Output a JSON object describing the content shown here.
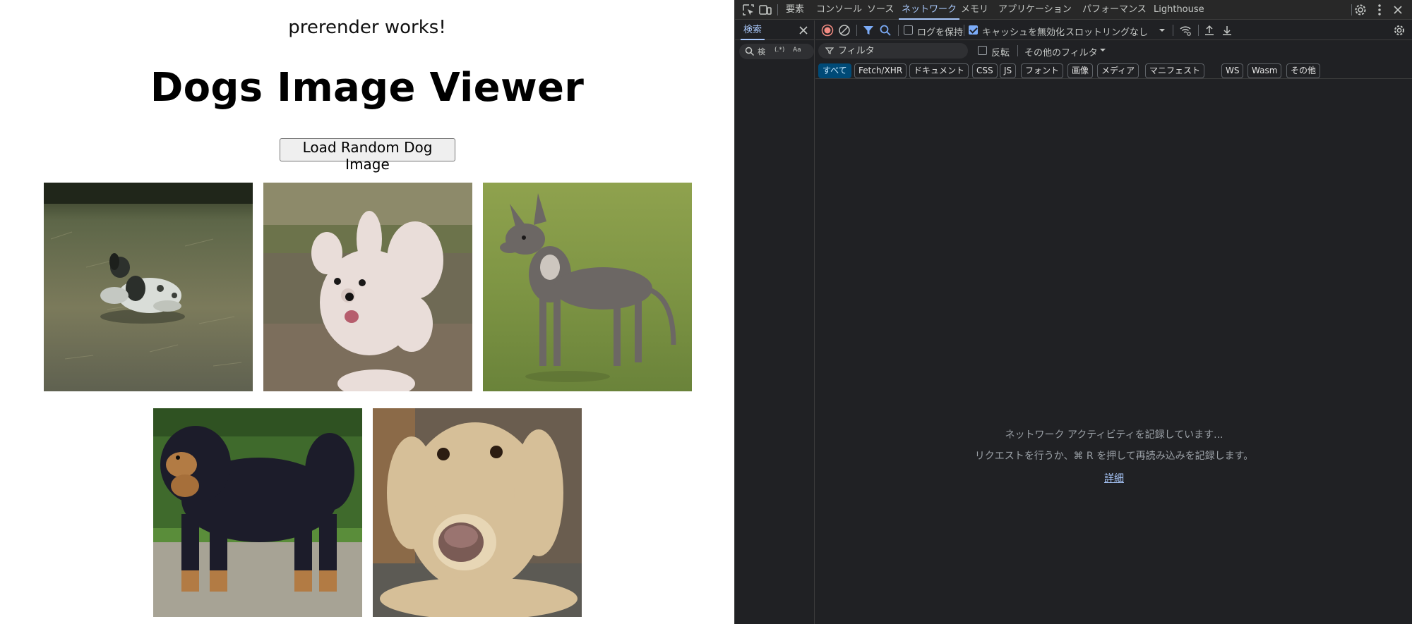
{
  "page": {
    "prerender_text": "prerender works!",
    "title": "Dogs Image Viewer",
    "load_button": "Load Random Dog Image",
    "dogs": [
      {
        "name": "spaniel-on-grass"
      },
      {
        "name": "fluffy-white-dog"
      },
      {
        "name": "hairless-dog"
      },
      {
        "name": "tibetan-mastiff"
      },
      {
        "name": "golden-retriever"
      }
    ]
  },
  "devtools": {
    "tabs": [
      "要素",
      "コンソール",
      "ソース",
      "ネットワーク",
      "メモリ",
      "アプリケーション",
      "パフォーマンス",
      "Lighthouse"
    ],
    "active_tab": "ネットワーク",
    "search_panel": {
      "tab_label": "検索",
      "placeholder": "検",
      "regex_label": "(.*)",
      "case_label": "Aa"
    },
    "toolbar": {
      "preserve_log_label": "ログを保持",
      "preserve_log_checked": false,
      "disable_cache_label": "キャッシュを無効化",
      "disable_cache_checked": true,
      "throttling_value": "スロットリングなし"
    },
    "filter": {
      "placeholder": "フィルタ",
      "invert_label": "反転",
      "more_filters_label": "その他のフィルタ"
    },
    "type_chips": [
      "すべて",
      "Fetch/XHR",
      "ドキュメント",
      "CSS",
      "JS",
      "フォント",
      "画像",
      "メディア",
      "マニフェスト",
      "WS",
      "Wasm",
      "その他"
    ],
    "active_chip": "すべて",
    "empty_state": {
      "line1": "ネットワーク アクティビティを記録しています...",
      "line2": "リクエストを行うか、⌘ R を押して再読み込みを記録します。",
      "link": "詳細"
    },
    "colors": {
      "background": "#202124",
      "accent": "#a8c7fa",
      "record_red": "#f28b82"
    }
  }
}
